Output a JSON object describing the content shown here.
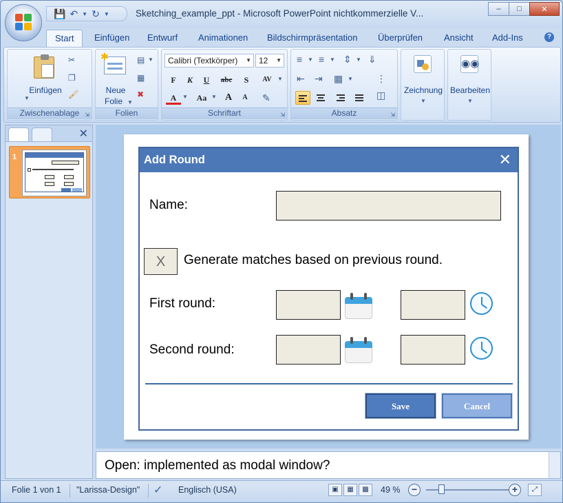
{
  "window": {
    "title": "Sketching_example_ppt - Microsoft PowerPoint nichtkommerzielle V...",
    "controls": {
      "minimize": "–",
      "maximize": "□",
      "close": "✕"
    }
  },
  "quick_access": {
    "save_icon": "save-icon",
    "undo_icon": "undo-icon",
    "redo_icon": "redo-icon"
  },
  "tabs": [
    "Start",
    "Einfügen",
    "Entwurf",
    "Animationen",
    "Bildschirmpräsentation",
    "Überprüfen",
    "Ansicht",
    "Add-Ins"
  ],
  "active_tab": "Start",
  "ribbon": {
    "clipboard": {
      "label": "Zwischenablage",
      "paste": "Einfügen"
    },
    "slides": {
      "label": "Folien",
      "new_slide_line1": "Neue",
      "new_slide_line2": "Folie"
    },
    "font": {
      "label": "Schriftart",
      "font_name": "Calibri (Textkörper)",
      "font_size": "12",
      "bold": "F",
      "italic": "K",
      "underline": "U",
      "strike": "abc",
      "shadow": "S",
      "spacing": "AV",
      "color": "A",
      "case": "Aa",
      "grow": "A",
      "shrink": "A"
    },
    "paragraph": {
      "label": "Absatz"
    },
    "drawing": {
      "label": "Zeichnung"
    },
    "editing": {
      "label": "Bearbeiten"
    }
  },
  "slide_panel": {
    "slide_number": "1"
  },
  "dialog": {
    "title": "Add Round",
    "close": "✕",
    "name_label": "Name:",
    "checkbox_mark": "X",
    "generate_label": "Generate matches based on previous round.",
    "first_round_label": "First round:",
    "second_round_label": "Second round:",
    "save_label": "Save",
    "cancel_label": "Cancel"
  },
  "notes": {
    "text": "Open: implemented as modal window?"
  },
  "status": {
    "slide_info": "Folie 1 von 1",
    "theme": "\"Larissa-Design\"",
    "language": "Englisch (USA)",
    "zoom": "49 %"
  }
}
